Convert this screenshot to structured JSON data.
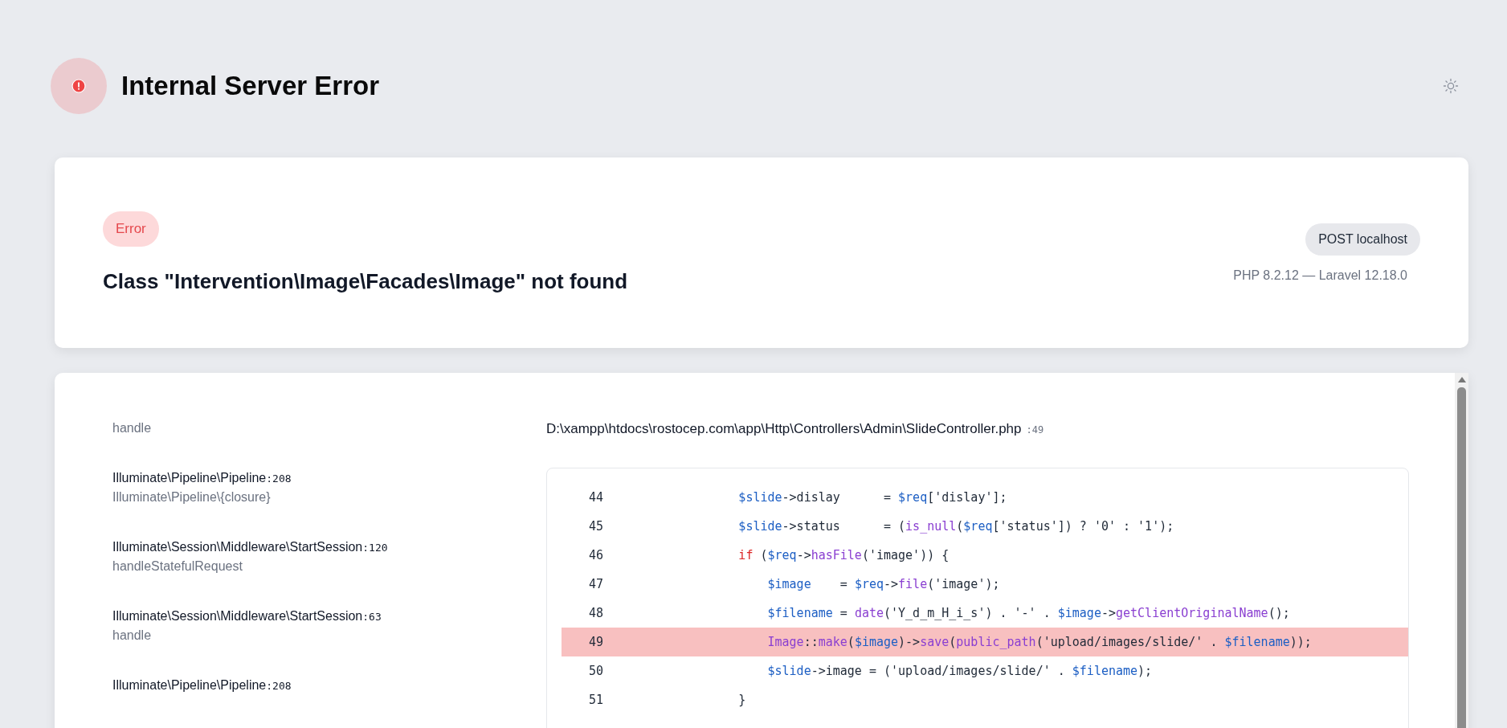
{
  "header": {
    "title": "Internal Server Error"
  },
  "exception": {
    "badge": "Error",
    "message": "Class \"Intervention\\Image\\Facades\\Image\" not found",
    "request": "POST localhost",
    "versions": "PHP 8.2.12 — Laravel 12.18.0"
  },
  "frames": [
    {
      "function": "handle"
    },
    {
      "class": "Illuminate\\Pipeline\\Pipeline",
      "line": ":208",
      "function": "Illuminate\\Pipeline\\{closure}"
    },
    {
      "class": "Illuminate\\Session\\Middleware\\StartSession",
      "line": ":120",
      "function": "handleStatefulRequest"
    },
    {
      "class": "Illuminate\\Session\\Middleware\\StartSession",
      "line": ":63",
      "function": "handle"
    },
    {
      "class": "Illuminate\\Pipeline\\Pipeline",
      "line": ":208"
    }
  ],
  "source": {
    "file": "D:\\xampp\\htdocs\\rostocep.com\\app\\Http\\Controllers\\Admin\\SlideController.php",
    "line": ":49",
    "lines": [
      {
        "number": "44",
        "highlighted": false,
        "tokens": [
          {
            "kind": "var",
            "text": "            $slide"
          },
          {
            "kind": "plain",
            "text": "->dislay      = "
          },
          {
            "kind": "var",
            "text": "$req"
          },
          {
            "kind": "plain",
            "text": "['dislay'];"
          }
        ]
      },
      {
        "number": "45",
        "highlighted": false,
        "tokens": [
          {
            "kind": "var",
            "text": "            $slide"
          },
          {
            "kind": "plain",
            "text": "->status      = ("
          },
          {
            "kind": "func",
            "text": "is_null"
          },
          {
            "kind": "plain",
            "text": "("
          },
          {
            "kind": "var",
            "text": "$req"
          },
          {
            "kind": "plain",
            "text": "['status']) ? '0' : '1');"
          }
        ]
      },
      {
        "number": "46",
        "highlighted": false,
        "tokens": [
          {
            "kind": "keyword",
            "text": "            if"
          },
          {
            "kind": "plain",
            "text": " ("
          },
          {
            "kind": "var",
            "text": "$req"
          },
          {
            "kind": "plain",
            "text": "->"
          },
          {
            "kind": "func",
            "text": "hasFile"
          },
          {
            "kind": "plain",
            "text": "('image')) {"
          }
        ]
      },
      {
        "number": "47",
        "highlighted": false,
        "tokens": [
          {
            "kind": "var",
            "text": "                $image"
          },
          {
            "kind": "plain",
            "text": "    = "
          },
          {
            "kind": "var",
            "text": "$req"
          },
          {
            "kind": "plain",
            "text": "->"
          },
          {
            "kind": "func",
            "text": "file"
          },
          {
            "kind": "plain",
            "text": "('image');"
          }
        ]
      },
      {
        "number": "48",
        "highlighted": false,
        "tokens": [
          {
            "kind": "var",
            "text": "                $filename"
          },
          {
            "kind": "plain",
            "text": " = "
          },
          {
            "kind": "func",
            "text": "date"
          },
          {
            "kind": "plain",
            "text": "('Y_d_m_H_i_s') . '-' . "
          },
          {
            "kind": "var",
            "text": "$image"
          },
          {
            "kind": "plain",
            "text": "->"
          },
          {
            "kind": "func",
            "text": "getClientOriginalName"
          },
          {
            "kind": "plain",
            "text": "();"
          }
        ]
      },
      {
        "number": "49",
        "highlighted": true,
        "tokens": [
          {
            "kind": "func",
            "text": "                Image"
          },
          {
            "kind": "plain",
            "text": "::"
          },
          {
            "kind": "func",
            "text": "make"
          },
          {
            "kind": "plain",
            "text": "("
          },
          {
            "kind": "var",
            "text": "$image"
          },
          {
            "kind": "plain",
            "text": ")->"
          },
          {
            "kind": "func",
            "text": "save"
          },
          {
            "kind": "plain",
            "text": "("
          },
          {
            "kind": "func",
            "text": "public_path"
          },
          {
            "kind": "plain",
            "text": "('upload/images/slide/' . "
          },
          {
            "kind": "var",
            "text": "$filename"
          },
          {
            "kind": "plain",
            "text": "));"
          }
        ]
      },
      {
        "number": "50",
        "highlighted": false,
        "tokens": [
          {
            "kind": "var",
            "text": "                $slide"
          },
          {
            "kind": "plain",
            "text": "->image = ('upload/images/slide/' . "
          },
          {
            "kind": "var",
            "text": "$filename"
          },
          {
            "kind": "plain",
            "text": ");"
          }
        ]
      },
      {
        "number": "51",
        "highlighted": false,
        "tokens": [
          {
            "kind": "plain",
            "text": "            }"
          }
        ]
      }
    ]
  }
}
